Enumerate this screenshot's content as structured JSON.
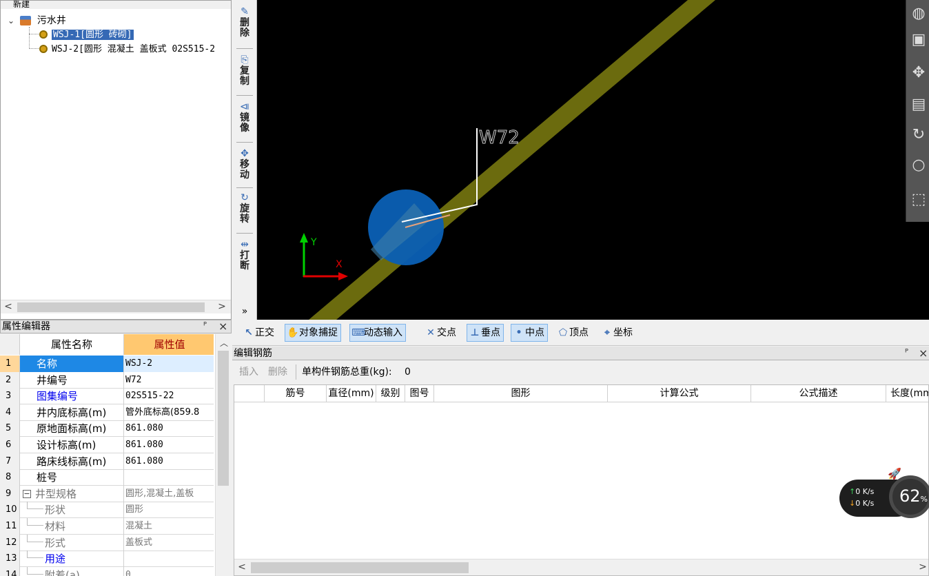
{
  "tree": {
    "root_label": "污水井",
    "items": [
      {
        "label": "WSJ-1[圆形 砖砌]",
        "selected": true
      },
      {
        "label": "WSJ-2[圆形 混凝土 盖板式  02S515-2",
        "selected": false
      }
    ],
    "toolbar_new": "新建",
    "scroll_left": "<",
    "scroll_right": ">"
  },
  "vtools": [
    {
      "icon": "✎",
      "label": "删除"
    },
    {
      "icon": "⎘",
      "label": "复制"
    },
    {
      "icon": "⧏",
      "label": "镜像"
    },
    {
      "icon": "✥",
      "label": "移动"
    },
    {
      "icon": "↻",
      "label": "旋转"
    },
    {
      "icon": "⇹",
      "label": "打断"
    }
  ],
  "vstrip_more": "»",
  "canvas": {
    "well_label": "W72",
    "axis_y": "Y",
    "axis_x": "X",
    "colors": {
      "pipe": "#6b6b0e",
      "well": "#0a5fb3",
      "leader": "#ffffff",
      "axis_y": "#00d000",
      "axis_x": "#e00000"
    }
  },
  "snap": [
    {
      "icon": "↖",
      "label": "正交",
      "on": false
    },
    {
      "icon": "✋",
      "label": "对象捕捉",
      "on": true
    },
    {
      "icon": "⌨",
      "label": "动态输入",
      "on": true
    },
    {
      "icon": "✕",
      "label": "交点",
      "on": false
    },
    {
      "icon": "⊥",
      "label": "垂点",
      "on": true
    },
    {
      "icon": "•",
      "label": "中点",
      "on": true
    },
    {
      "icon": "⬠",
      "label": "顶点",
      "on": false
    },
    {
      "icon": "⌖",
      "label": "坐标",
      "on": false
    }
  ],
  "prop": {
    "title": "属性编辑器",
    "pin": "ᴾ",
    "close": "×",
    "col_name": "属性名称",
    "col_value": "属性值",
    "rows": [
      {
        "num": "1",
        "name": "名称",
        "value": "WSJ-2",
        "style": "blue"
      },
      {
        "num": "2",
        "name": "井编号",
        "value": "W72",
        "style": ""
      },
      {
        "num": "3",
        "name": "图集编号",
        "value": "02S515-22",
        "style": "blue"
      },
      {
        "num": "4",
        "name": "井内底标高(m)",
        "value": "管外底标高(859.8",
        "style": ""
      },
      {
        "num": "5",
        "name": "原地面标高(m)",
        "value": "861.080",
        "style": ""
      },
      {
        "num": "6",
        "name": "设计标高(m)",
        "value": "861.080",
        "style": ""
      },
      {
        "num": "7",
        "name": "路床线标高(m)",
        "value": "861.080",
        "style": ""
      },
      {
        "num": "8",
        "name": "桩号",
        "value": "",
        "style": ""
      },
      {
        "num": "9",
        "name": "井型规格",
        "value": "圆形,混凝土,盖板",
        "style": "gray-group"
      },
      {
        "num": "10",
        "name": "形状",
        "value": "圆形",
        "style": "gray-child"
      },
      {
        "num": "11",
        "name": "材料",
        "value": "混凝土",
        "style": "gray-child"
      },
      {
        "num": "12",
        "name": "形式",
        "value": "盖板式",
        "style": "gray-child"
      },
      {
        "num": "13",
        "name": "用途",
        "value": "",
        "style": "blue-child"
      },
      {
        "num": "14",
        "name": "附着(a)",
        "value": "0",
        "style": "gray-child"
      }
    ],
    "collapse_sign": "−"
  },
  "rebar": {
    "title": "编辑钢筋",
    "pin": "ᴾ",
    "close": "×",
    "insert": "插入",
    "delete": "删除",
    "total_label": "单构件钢筋总重(kg):",
    "total_value": "0",
    "columns": [
      "筋号",
      "直径(mm)",
      "级别",
      "图号",
      "图形",
      "计算公式",
      "公式描述",
      "长度(mm)"
    ]
  },
  "net": {
    "up": "0  K/s",
    "down": "0  K/s",
    "percent": "62",
    "percent_unit": "%"
  }
}
